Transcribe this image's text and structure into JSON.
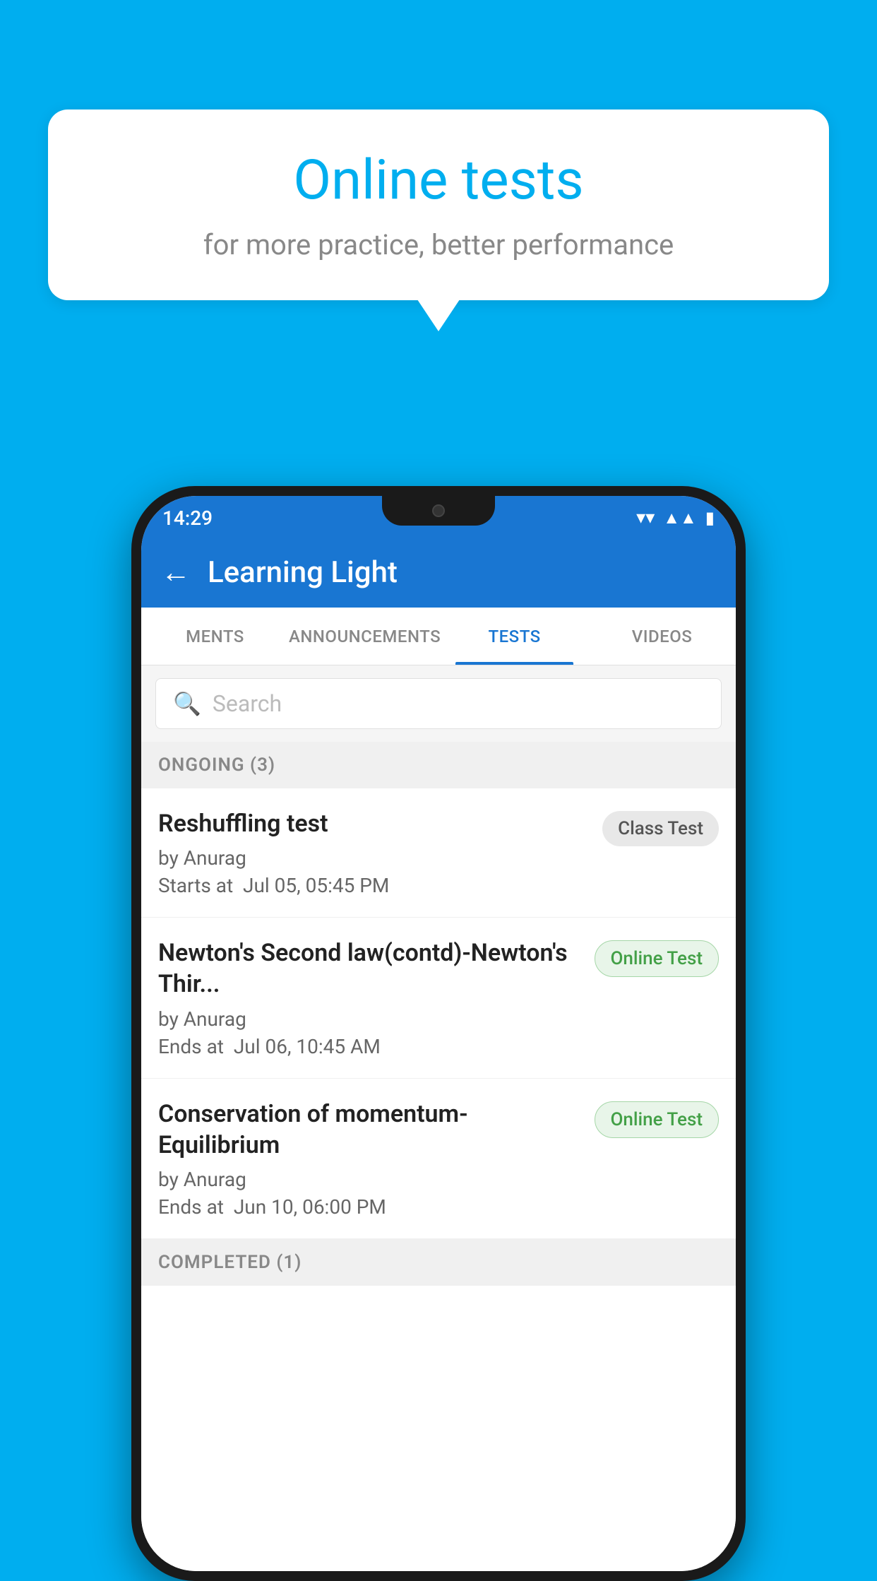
{
  "background": {
    "color": "#00AEEF"
  },
  "speech_bubble": {
    "title": "Online tests",
    "subtitle": "for more practice, better performance"
  },
  "phone": {
    "status_bar": {
      "time": "14:29",
      "icons": [
        "wifi",
        "signal",
        "battery"
      ]
    },
    "app_bar": {
      "title": "Learning Light",
      "back_label": "←"
    },
    "tabs": [
      {
        "label": "MENTS",
        "active": false
      },
      {
        "label": "ANNOUNCEMENTS",
        "active": false
      },
      {
        "label": "TESTS",
        "active": true
      },
      {
        "label": "VIDEOS",
        "active": false
      }
    ],
    "search": {
      "placeholder": "Search"
    },
    "ongoing_section": {
      "header": "ONGOING (3)",
      "tests": [
        {
          "name": "Reshuffling test",
          "author": "by Anurag",
          "date_label": "Starts at",
          "date": "Jul 05, 05:45 PM",
          "badge": "Class Test",
          "badge_type": "class"
        },
        {
          "name": "Newton's Second law(contd)-Newton's Thir...",
          "author": "by Anurag",
          "date_label": "Ends at",
          "date": "Jul 06, 10:45 AM",
          "badge": "Online Test",
          "badge_type": "online"
        },
        {
          "name": "Conservation of momentum-Equilibrium",
          "author": "by Anurag",
          "date_label": "Ends at",
          "date": "Jun 10, 06:00 PM",
          "badge": "Online Test",
          "badge_type": "online"
        }
      ]
    },
    "completed_section": {
      "header": "COMPLETED (1)"
    }
  }
}
